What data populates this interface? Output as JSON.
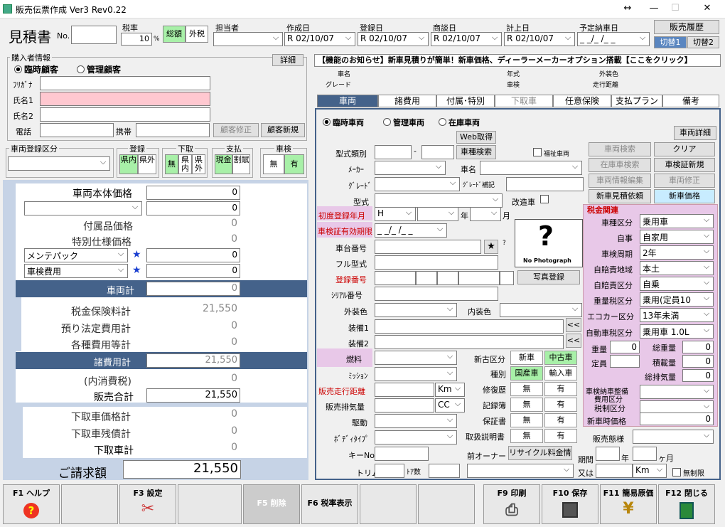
{
  "window": {
    "title": "販売伝票作成 Ver3 Rev0.22"
  },
  "header": {
    "doc_type": "見積書",
    "no_label": "No.",
    "tax_rate_label": "税率",
    "tax_rate": "10",
    "tax_pct": "%",
    "tax_incl": "総額",
    "tax_excl": "外税",
    "staff_label": "担当者",
    "created_label": "作成日",
    "created": "R 02/10/07",
    "registered_label": "登録日",
    "registered": "R 02/10/07",
    "negotiated_label": "商談日",
    "negotiated": "R 02/10/07",
    "booked_label": "計上日",
    "booked": "R 02/10/07",
    "delivery_label": "予定納車日",
    "delivery": "_ _/_ /_ _",
    "history_btn": "販売履歴",
    "switch1": "切替1",
    "switch2": "切替2"
  },
  "buyer": {
    "group": "購入者情報",
    "detail_btn": "詳細",
    "radio_temp": "臨時顧客",
    "radio_managed": "管理顧客",
    "furigana": "ﾌﾘｶﾞﾅ",
    "name1": "氏名1",
    "name2": "氏名2",
    "phone": "電話",
    "mobile": "携帯",
    "edit_btn": "顧客修正",
    "new_btn": "顧客新規"
  },
  "regs": {
    "vehicle_reg": "車両登録区分",
    "reg": "登録",
    "reg_a": "県内",
    "reg_b": "県外",
    "trade": "下取",
    "trade_a": "無",
    "trade_b": "県内",
    "trade_c": "県外",
    "pay": "支払",
    "pay_a": "現金",
    "pay_b": "割賦",
    "inspect": "車検",
    "insp_a": "無",
    "insp_b": "有"
  },
  "left": {
    "body_price": "車両本体価格",
    "body_price_v": "0",
    "opt_v": "0",
    "parts": "付属品価格",
    "parts_v": "0",
    "spec": "特別仕様価格",
    "spec_v": "0",
    "maint": "メンテパック",
    "maint_v": "0",
    "insp": "車検費用",
    "insp_v": "0",
    "vehicle_total": "車両計",
    "vehicle_total_v": "0",
    "tax_ins": "税金保険料計",
    "tax_ins_v": "21,550",
    "deposit": "預り法定費用計",
    "deposit_v": "0",
    "misc": "各種費用等計",
    "misc_v": "0",
    "fees_total": "諸費用計",
    "fees_total_v": "21,550",
    "incl_tax": "(内消費税)",
    "incl_tax_v": "0",
    "sales_total": "販売合計",
    "sales_total_v": "21,550",
    "trade_price": "下取車価格計",
    "trade_price_v": "0",
    "trade_debt": "下取車残債計",
    "trade_debt_v": "0",
    "trade_total": "下取車計",
    "trade_total_v": "0",
    "invoice": "ご請求額",
    "invoice_v": "21,550"
  },
  "notice": "【機能のお知らせ】新車見積りが簡単！新車価格、ディーラーメーカーオプション搭載【ここをクリック】",
  "summary": {
    "car_name": "車名",
    "grade": "グレード",
    "year": "年式",
    "vin": "車検",
    "color": "外装色",
    "mileage": "走行距離"
  },
  "tabs": [
    "車両",
    "諸費用",
    "付属･特別",
    "下取車",
    "任意保険",
    "支払プラン",
    "備考"
  ],
  "vehicle": {
    "r_temp": "臨時車両",
    "r_managed": "管理車両",
    "r_stock": "在庫車両",
    "detail_btn": "車両詳細",
    "web_btn": "Web取得",
    "type_cat": "型式類別",
    "dash": "-",
    "model_search": "車種検索",
    "welfare": "福祉車両",
    "veh_search": "車両検索",
    "clear": "クリア",
    "stock_search": "在庫車検索",
    "cert_new": "車検証新規",
    "veh_info": "車両情報編集",
    "veh_edit": "車両修正",
    "new_quote": "新車見積依頼",
    "new_price": "新車価格",
    "maker": "ﾒｰｶｰ",
    "carname": "車名",
    "grade": "ｸﾞﾚｰﾄﾞ",
    "grade_sup": "ｸﾞﾚｰﾄﾞ補記",
    "model": "型式",
    "modified": "改造車",
    "first_reg": "初度登録年月",
    "first_reg_era": "H",
    "year_u": "年",
    "month_u": "月",
    "cert_exp": "車検証有効期限",
    "cert_exp_v": "_ _/_ /_ _",
    "chassis": "車台番号",
    "star": "★",
    "q": "?",
    "full_model": "フル型式",
    "reg_no": "登録番号",
    "serial": "ｼﾘｱﾙ番号",
    "no_photo": "No Photograph",
    "photo_btn": "写真登録",
    "ext_color": "外装色",
    "int_color": "内装色",
    "equip1": "装備1",
    "equip2": "装備2",
    "arrow": "<<",
    "fuel": "燃料",
    "newused": "新古区分",
    "new": "新車",
    "used": "中古車",
    "mission": "ﾐｯｼｮﾝ",
    "kind": "種別",
    "domestic": "国産車",
    "import": "輸入車",
    "sale_km": "販売走行距離",
    "km": "Km",
    "repair": "修復歴",
    "none": "無",
    "have": "有",
    "sale_cc": "販売排気量",
    "cc": "CC",
    "record": "記録簿",
    "drive": "駆動",
    "warranty": "保証書",
    "body": "ﾎﾞﾃﾞｨﾀｲﾌﾟ",
    "manual": "取扱説明書",
    "key": "キーNo",
    "prev_owner": "前オーナー",
    "recycle": "リサイクル料金情報",
    "trim": "トリム",
    "doors": "ﾄｱ数"
  },
  "taxbox": {
    "title": "税金関連",
    "kind": "車種区分",
    "kind_v": "乗用車",
    "own": "自事",
    "own_v": "自家用",
    "cycle": "車検周期",
    "cycle_v": "2年",
    "area": "自賠責地域",
    "area_v": "本土",
    "cali": "自賠責区分",
    "cali_v": "自乗",
    "weight_tax": "重量税区分",
    "weight_tax_v": "乗用(定員10",
    "eco": "エコカー区分",
    "eco_v": "13年未満",
    "auto_tax": "自動車税区分",
    "auto_tax_v": "乗用車 1.0L",
    "weight": "重量",
    "weight_v": "0",
    "gross": "総重量",
    "gross_v": "0",
    "capacity": "定員",
    "load": "積載量",
    "load_v": "0",
    "disp": "総排気量",
    "disp_v": "0",
    "delivery_fee": "車検納車整備",
    "fee_div": "費用区分",
    "tax_div": "税制区分",
    "new_price": "新車時価格",
    "new_price_v": "0",
    "sales_form": "販売態様",
    "period": "期間",
    "year": "年",
    "month": "ヶ月",
    "or": "又は",
    "km": "Km",
    "unlimited": "無制限"
  },
  "fkeys": [
    "F1 ヘルプ",
    "",
    "F3 設定",
    "",
    "F5 削除",
    "F6 税率表示",
    "",
    "",
    "F9 印刷",
    "F10 保存",
    "F11 簡易原価",
    "F12 閉じる"
  ]
}
